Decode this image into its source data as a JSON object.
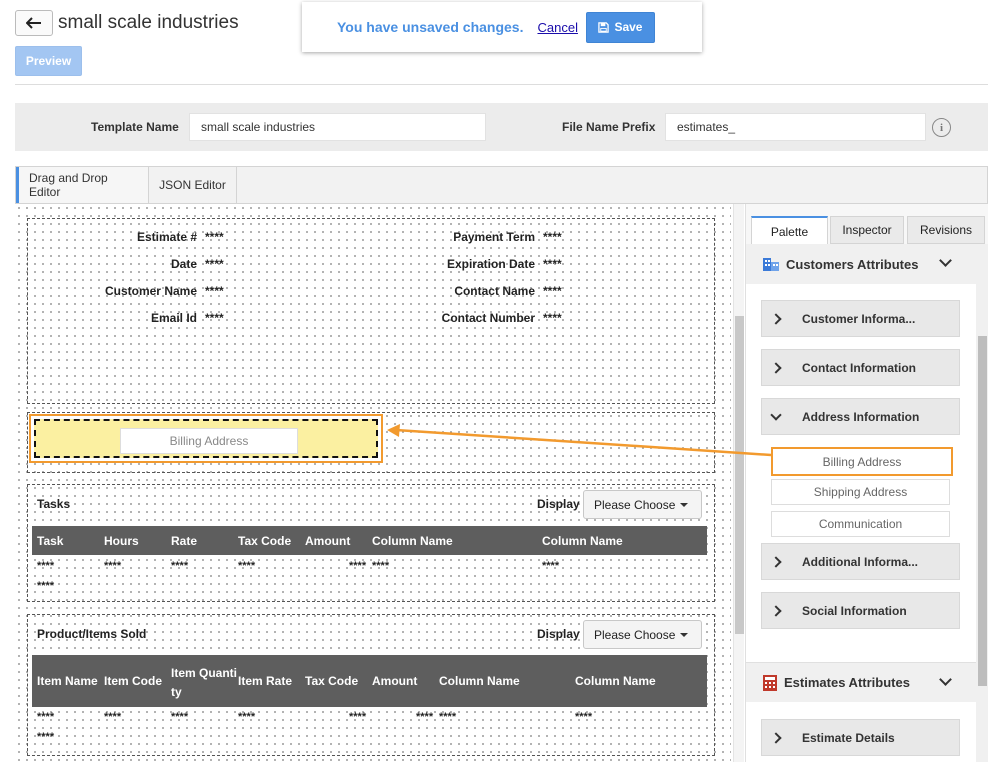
{
  "header": {
    "title": "small scale industries",
    "back_icon": "arrow-left-icon",
    "preview_label": "Preview"
  },
  "unsaved": {
    "message": "You have unsaved changes.",
    "cancel_label": "Cancel",
    "save_label": "Save",
    "save_icon": "floppy-disk-icon"
  },
  "template_form": {
    "template_name_label": "Template Name",
    "template_name_value": "small scale industries",
    "prefix_label": "File Name Prefix",
    "prefix_value": "estimates_",
    "info_icon": "info-icon"
  },
  "editor_tabs": [
    "Drag and Drop Editor",
    "JSON Editor"
  ],
  "canvas": {
    "left_fields": [
      {
        "label": "Estimate #",
        "value": "****"
      },
      {
        "label": "Date",
        "value": "****"
      },
      {
        "label": "Customer Name",
        "value": "****"
      },
      {
        "label": "Email Id",
        "value": "****"
      }
    ],
    "right_fields": [
      {
        "label": "Payment Term",
        "value": "****"
      },
      {
        "label": "Expiration Date",
        "value": "****"
      },
      {
        "label": "Contact Name",
        "value": "****"
      },
      {
        "label": "Contact Number",
        "value": "****"
      }
    ],
    "billing_drop_label": "Billing Address",
    "tasks": {
      "title": "Tasks",
      "display_label": "Display",
      "choose_label": "Please Choose",
      "columns": [
        "Task",
        "Hours",
        "Rate",
        "Tax Code",
        "Amount",
        "Column Name",
        "Column Name"
      ],
      "row1": [
        "****",
        "****",
        "****",
        "****",
        "****",
        "****",
        "****"
      ],
      "row2": [
        "****"
      ]
    },
    "products": {
      "title": "Product/Items Sold",
      "display_label": "Display",
      "choose_label": "Please Choose",
      "columns": [
        "Item Name",
        "Item Code",
        "Item Quantity",
        "Item Rate",
        "Tax Code",
        "Amount",
        "Column Name",
        "Column Name"
      ],
      "row1": [
        "****",
        "****",
        "****",
        "****",
        "****",
        "****",
        "****",
        "****"
      ],
      "row2": [
        "****"
      ]
    }
  },
  "palette": {
    "tabs": [
      "Palette",
      "Inspector",
      "Revisions"
    ],
    "customers_group": "Customers Attributes",
    "customers_icon": "building-icon",
    "items": [
      "Customer Informa...",
      "Contact Information",
      "Address Information"
    ],
    "address_subitems": [
      "Billing Address",
      "Shipping Address",
      "Communication"
    ],
    "items_after": [
      "Additional Informa...",
      "Social Information"
    ],
    "estimates_group": "Estimates Attributes",
    "estimates_icon": "calculator-icon",
    "estimate_items": [
      "Estimate Details"
    ]
  },
  "colors": {
    "accent": "#4a90e2",
    "highlight": "#f29a2e",
    "drop_zone": "#fbf0a1",
    "table_header": "#5e5e5e"
  }
}
